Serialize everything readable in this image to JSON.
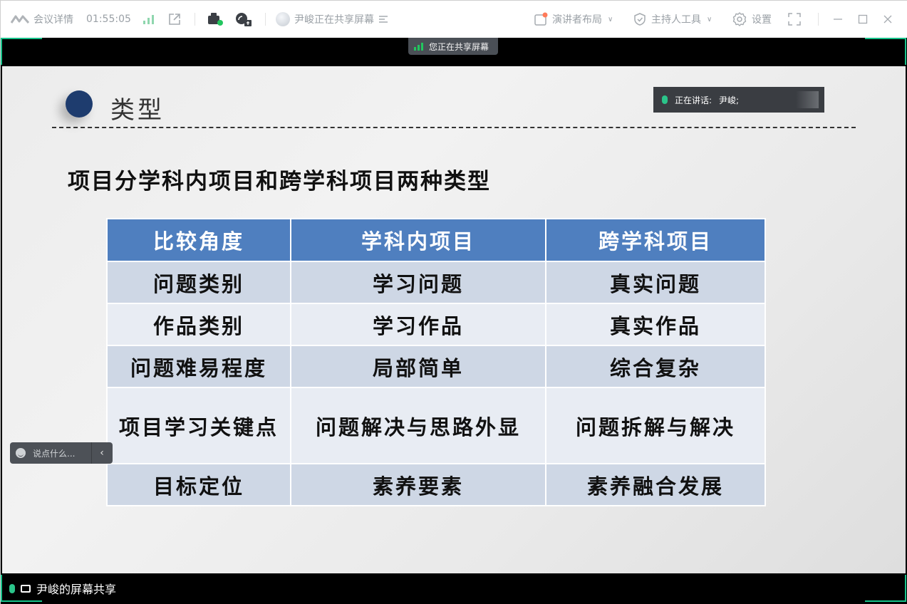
{
  "titlebar": {
    "meeting_info_label": "会议详情",
    "elapsed_time": "01:55:05",
    "sharer_status": "尹峻正在共享屏幕",
    "layout_label": "演讲者布局",
    "host_tools_label": "主持人工具",
    "settings_label": "设置"
  },
  "share": {
    "sharing_badge": "您正在共享屏幕",
    "speaking_label": "正在讲话:",
    "speaking_name": "尹峻;",
    "chat_placeholder": "说点什么...",
    "footer_label": "尹峻的屏幕共享"
  },
  "slide": {
    "title": "类型",
    "subtitle": "项目分学科内项目和跨学科项目两种类型",
    "table": {
      "headers": [
        "比较角度",
        "学科内项目",
        "跨学科项目"
      ],
      "rows": [
        [
          "问题类别",
          "学习问题",
          "真实问题"
        ],
        [
          "作品类别",
          "学习作品",
          "真实作品"
        ],
        [
          "问题难易程度",
          "局部简单",
          "综合复杂"
        ],
        [
          "项目学习关键点",
          "问题解决与思路外显",
          "问题拆解与解决"
        ],
        [
          "目标定位",
          "素养要素",
          "素养融合发展"
        ]
      ]
    }
  },
  "colors": {
    "header_blue": "#4f7fbf",
    "row_dark": "#ced7e5",
    "row_light": "#e8ecf3",
    "accent_green": "#17c28a",
    "title_dot": "#1e3c6e"
  }
}
